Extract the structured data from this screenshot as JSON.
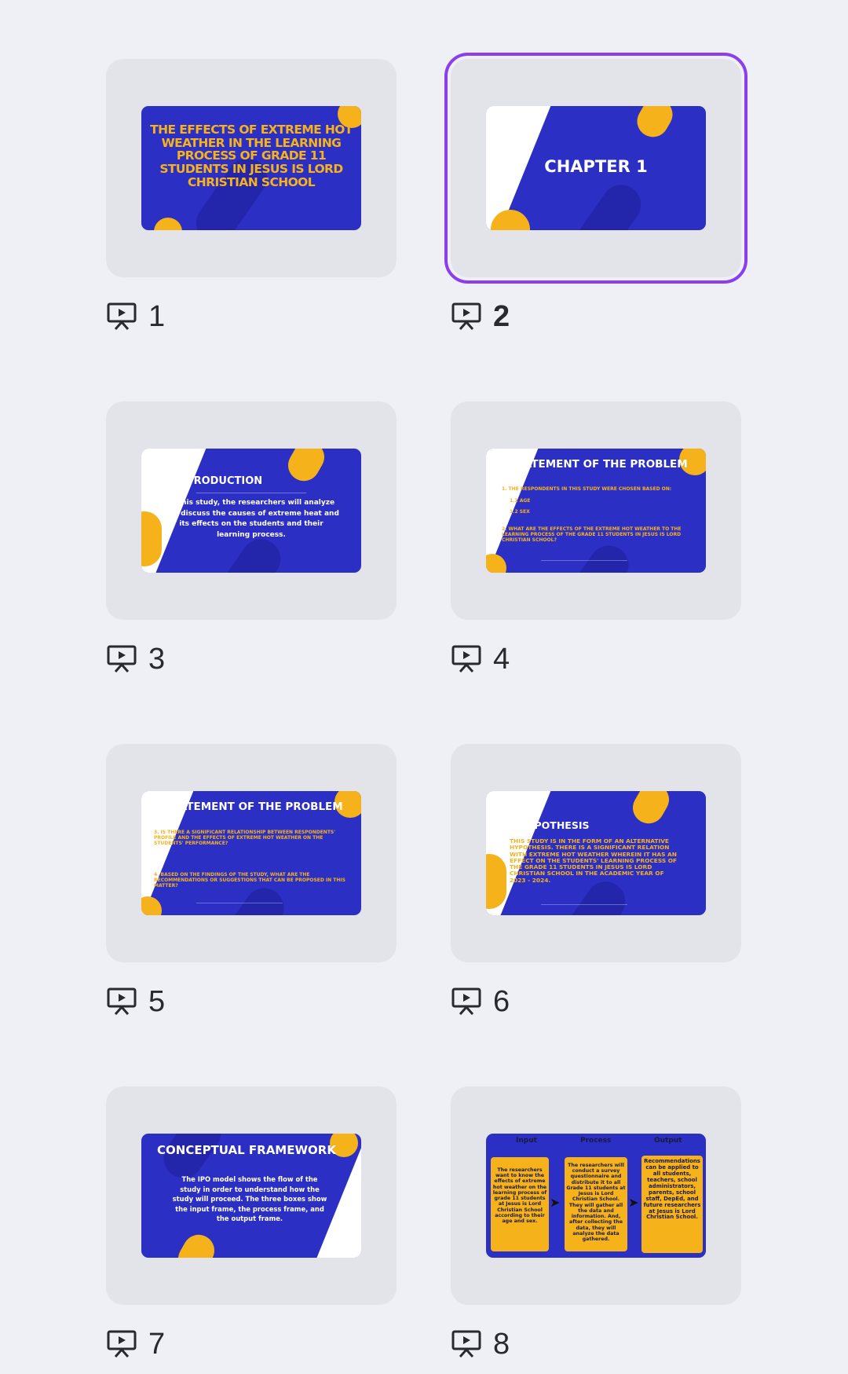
{
  "slides": [
    {
      "number": "1",
      "title": "THE EFFECTS OF EXTREME HOT WEATHER IN THE LEARNING PROCESS OF GRADE 11 STUDENTS IN JESUS IS LORD CHRISTIAN SCHOOL"
    },
    {
      "number": "2",
      "title": "CHAPTER 1",
      "selected": true
    },
    {
      "number": "3",
      "title": "INTRODUCTION",
      "body": "In this study, the researchers will analyze and discuss the causes of extreme heat and its effects on the students and their learning process."
    },
    {
      "number": "4",
      "title": "STATEMENT OF THE PROBLEM",
      "lines": [
        "1. THE RESPONDENTS IN THIS STUDY WERE CHOSEN BASED ON:",
        "1.1 AGE",
        "1.2 SEX",
        "2. WHAT ARE THE EFFECTS OF THE EXTREME HOT WEATHER TO THE LEARNING PROCESS OF THE GRADE 11 STUDENTS IN JESUS IS LORD CHRISTIAN SCHOOL?"
      ]
    },
    {
      "number": "5",
      "title": "STATEMENT OF THE PROBLEM",
      "lines": [
        "3. IS THERE A SIGNIFICANT RELATIONSHIP BETWEEN RESPONDENTS' PROFILE AND THE EFFECTS OF EXTREME HOT WEATHER ON THE STUDENTS' PERFORMANCE?",
        "4. BASED ON THE FINDINGS OF THE STUDY, WHAT ARE THE RECOMMENDATIONS OR SUGGESTIONS THAT CAN BE PROPOSED IN THIS MATTER?"
      ]
    },
    {
      "number": "6",
      "title": "HYPOTHESIS",
      "body": "THIS STUDY IS IN THE FORM OF AN ALTERNATIVE HYPOTHESIS. THERE IS A SIGNIFICANT RELATION WITH EXTREME HOT WEATHER WHEREIN IT HAS AN EFFECT ON THE STUDENTS' LEARNING PROCESS OF THE GRADE 11 STUDENTS IN JESUS IS LORD CHRISTIAN SCHOOL IN THE ACADEMIC YEAR OF 2023 - 2024."
    },
    {
      "number": "7",
      "title": "CONCEPTUAL FRAMEWORK",
      "body": "The IPO model shows the flow of the study in order to understand how the study will proceed. The three boxes show the input frame, the process frame, and the output frame."
    },
    {
      "number": "8",
      "columns": [
        "Input",
        "Process",
        "Output"
      ],
      "boxes": [
        "The researchers want to know the effects of extreme hot weather on the learning process of grade 11 students at Jesus is Lord Christian School according to their age and sex.",
        "The researchers will conduct a survey questionnaire and distribute it to all Grade 11 students at Jesus is Lord Christian School. They will gather all the data and information. And, after collecting the data, they will analyze the data gathered.",
        "Recommendations can be applied to all students, teachers, school administrators, parents, school staff, DepEd, and future researchers at Jesus is Lord Christian School."
      ]
    }
  ],
  "icons": {
    "slide_type": "presentation-icon"
  },
  "colors": {
    "slide_bg": "#2b2fc4",
    "accent": "#f6b21b",
    "selection": "#8b3df0"
  }
}
